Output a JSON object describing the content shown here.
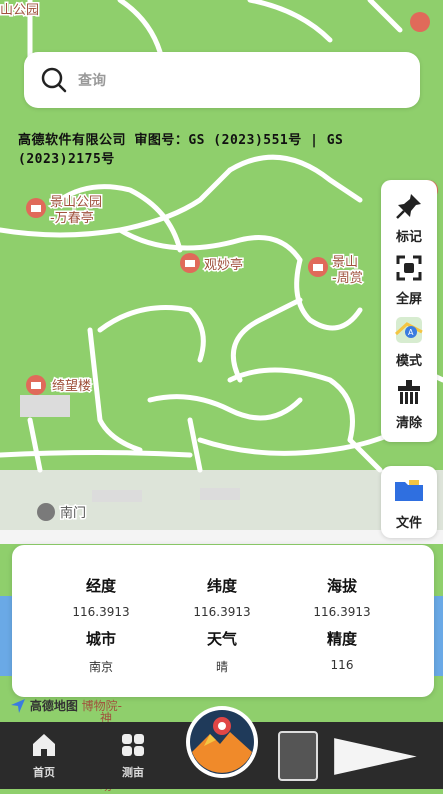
{
  "search": {
    "placeholder": "查询"
  },
  "copyright": "高德软件有限公司 审图号：GS (2023)551号 | GS (2023)2175号",
  "map_labels": {
    "jingshan_top": "山公园",
    "wanchunting_1": "景山公园",
    "wanchunting_2": "-万春亭",
    "guanmiaoting": "观妙亭",
    "zhoushang_1": "景山",
    "zhoushang_2": "-周赏",
    "qiwanglou": "绮望楼",
    "nanmen": "南门",
    "gaode_brand": "高德地图",
    "museum_1": "博物院-",
    "museum_2": "神武门广场"
  },
  "tools": [
    {
      "label": "标记",
      "icon": "pin-icon"
    },
    {
      "label": "全屏",
      "icon": "fullscreen-icon"
    },
    {
      "label": "模式",
      "icon": "map-mode-icon"
    },
    {
      "label": "清除",
      "icon": "clear-icon"
    }
  ],
  "file_button": {
    "label": "文件",
    "icon": "folder-icon"
  },
  "info": {
    "longitude": {
      "label": "经度",
      "value": "116.3913"
    },
    "latitude": {
      "label": "纬度",
      "value": "116.3913"
    },
    "altitude": {
      "label": "海拔",
      "value": "116.3913"
    },
    "city": {
      "label": "城市",
      "value": "南京"
    },
    "weather": {
      "label": "天气",
      "value": "晴"
    },
    "accuracy": {
      "label": "精度",
      "value": "116"
    }
  },
  "nav": {
    "home": "首页",
    "measure": "测亩"
  },
  "colors": {
    "map_green": "#8fcf6c",
    "path_white": "#ffffff",
    "poi_red": "#e06a5a",
    "bar_dark": "#2b2b2b",
    "folder_blue": "#2f6fe0"
  }
}
